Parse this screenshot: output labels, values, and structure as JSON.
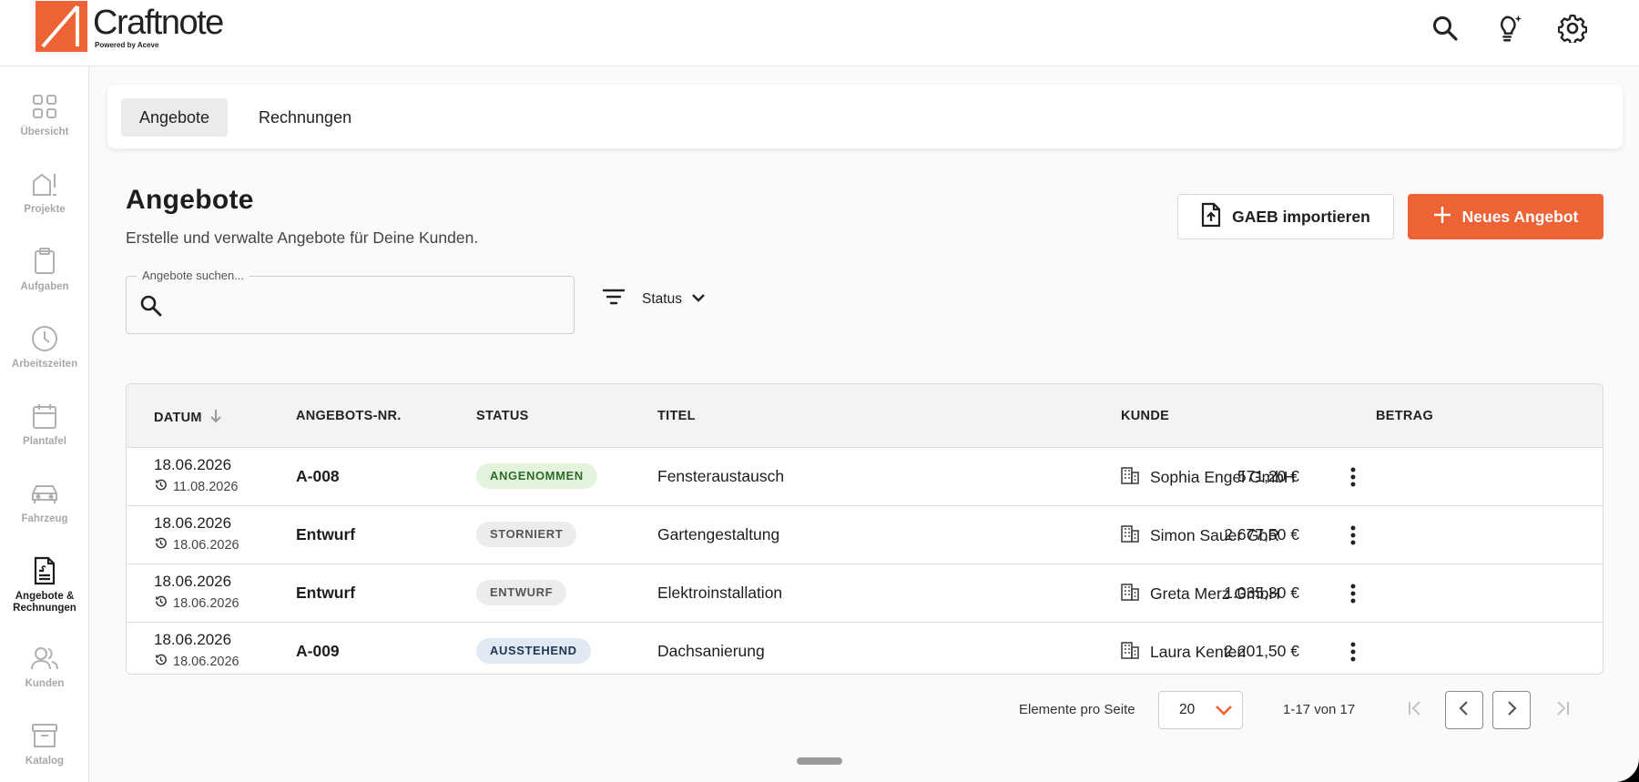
{
  "app": {
    "name": "Craftnote",
    "tagline": "Powered by Aceve",
    "accent_color": "#ee6335"
  },
  "header": {
    "icons": [
      "search-icon",
      "lightbulb-icon",
      "gear-icon"
    ]
  },
  "sidebar": {
    "items": [
      {
        "label": "Übersicht",
        "icon": "grid-icon",
        "active": false
      },
      {
        "label": "Projekte",
        "icon": "project-icon",
        "active": false
      },
      {
        "label": "Aufgaben",
        "icon": "clipboard-icon",
        "active": false
      },
      {
        "label": "Arbeitszeiten",
        "icon": "clock-icon",
        "active": false
      },
      {
        "label": "Plantafel",
        "icon": "calendar-icon",
        "active": false
      },
      {
        "label": "Fahrzeug",
        "icon": "car-icon",
        "active": false
      },
      {
        "label": "Angebote &",
        "label2": "Rechnungen",
        "icon": "invoice-icon",
        "active": true
      },
      {
        "label": "Kunden",
        "icon": "people-icon",
        "active": false
      },
      {
        "label": "Katalog",
        "icon": "archive-icon",
        "active": false
      }
    ]
  },
  "tabs": [
    {
      "label": "Angebote",
      "active": true
    },
    {
      "label": "Rechnungen",
      "active": false
    }
  ],
  "page": {
    "title": "Angebote",
    "subtitle": "Erstelle und verwalte Angebote für Deine Kunden.",
    "gaeb_button": "GAEB importieren",
    "new_button": "Neues Angebot"
  },
  "search": {
    "label": "Angebote suchen...",
    "value": "",
    "placeholder": ""
  },
  "filter": {
    "status_label": "Status"
  },
  "table": {
    "columns": [
      "DATUM",
      "ANGEBOTS-NR.",
      "STATUS",
      "TITEL",
      "KUNDE",
      "BETRAG"
    ],
    "sort_column": "DATUM",
    "rows": [
      {
        "date": "18.06.2026",
        "updated": "11.08.2026",
        "number": "A-008",
        "status": "ANGENOMMEN",
        "status_bg": "#e3f4dd",
        "status_fg": "#2e6b2a",
        "title": "Fensteraustausch",
        "customer": "Sophia Engel GmbH",
        "amount": "571,20 €"
      },
      {
        "date": "18.06.2026",
        "updated": "18.06.2026",
        "number": "Entwurf",
        "status": "STORNIERT",
        "status_bg": "#ececec",
        "status_fg": "#555555",
        "title": "Gartengestaltung",
        "customer": "Simon Sauer GbR",
        "amount": "2.677,50 €"
      },
      {
        "date": "18.06.2026",
        "updated": "18.06.2026",
        "number": "Entwurf",
        "status": "ENTWURF",
        "status_bg": "#ececec",
        "status_fg": "#555555",
        "title": "Elektroinstallation",
        "customer": "Greta Merz GmbH",
        "amount": "1.035,30 €"
      },
      {
        "date": "18.06.2026",
        "updated": "18.06.2026",
        "number": "A-009",
        "status": "AUSSTEHEND",
        "status_bg": "#e1e9f4",
        "status_fg": "#1f3552",
        "title": "Dachsanierung",
        "customer": "Laura Kenten",
        "amount": "2.201,50 €"
      }
    ]
  },
  "pagination": {
    "per_page_label": "Elemente pro Seite",
    "per_page_value": "20",
    "range": "1-17 von 17"
  }
}
